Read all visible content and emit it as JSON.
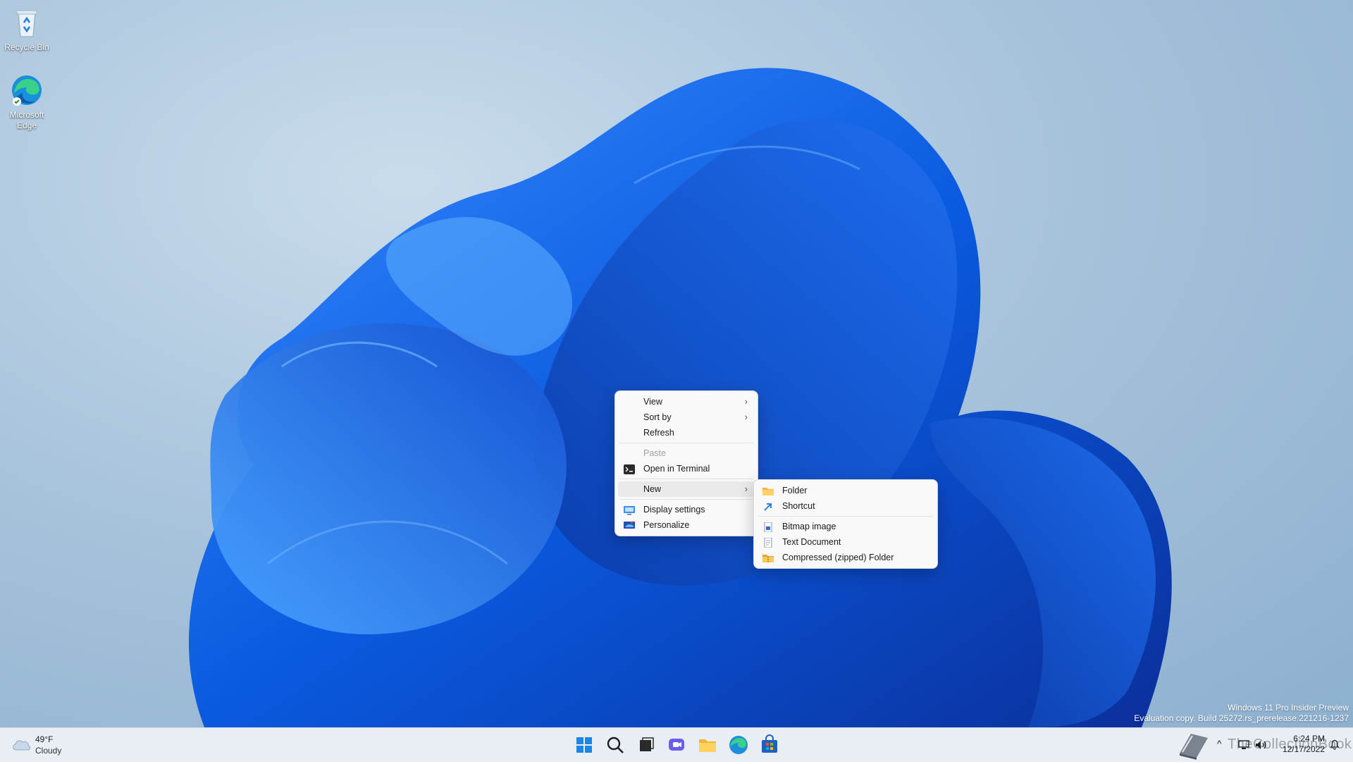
{
  "desktop_icons": [
    {
      "label": "Recycle Bin",
      "icon": "recycle-bin-icon"
    },
    {
      "label": "Microsoft Edge",
      "icon": "edge-icon"
    }
  ],
  "context_menu": {
    "view": "View",
    "sort_by": "Sort by",
    "refresh": "Refresh",
    "paste": "Paste",
    "open_terminal": "Open in Terminal",
    "new": "New",
    "display_settings": "Display settings",
    "personalize": "Personalize"
  },
  "new_submenu": {
    "folder": "Folder",
    "shortcut": "Shortcut",
    "bitmap": "Bitmap image",
    "text_document": "Text Document",
    "zipped_folder": "Compressed (zipped) Folder"
  },
  "watermark": {
    "line1": "Windows 11 Pro Insider Preview",
    "line2": "Evaluation copy. Build 25272.rs_prerelease.221216-1237"
  },
  "taskbar": {
    "weather": {
      "temp": "49°F",
      "condition": "Cloudy"
    },
    "clock": {
      "time": "6:24 PM",
      "date": "12/17/2022"
    },
    "overlay_text": "TheCollectionBook",
    "pinned": [
      "start-icon",
      "search-icon",
      "task-view-icon",
      "chat-icon",
      "file-explorer-icon",
      "edge-icon",
      "store-icon"
    ]
  },
  "colors": {
    "accent": "#0067c0",
    "menu_bg": "#f9f9f9",
    "taskbar_bg": "#e9eef4"
  }
}
